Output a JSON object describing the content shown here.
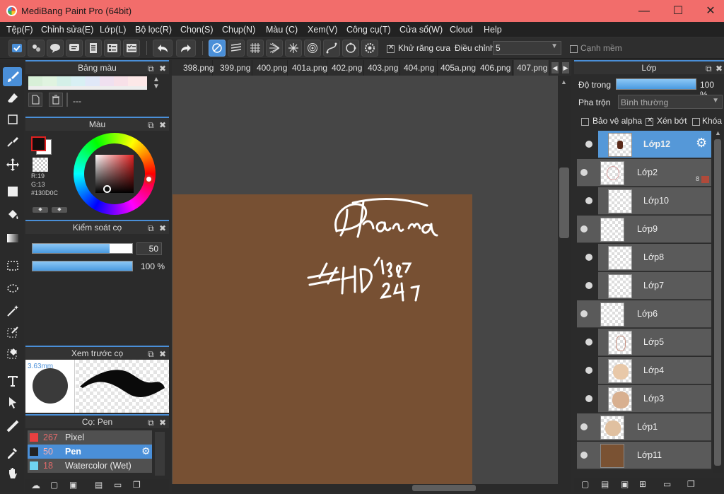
{
  "window": {
    "title": "MediBang Paint Pro (64bit)",
    "min": "—",
    "max": "☐",
    "close": "✕"
  },
  "menu": [
    "Tệp(F)",
    "Chỉnh sửa(E)",
    "Lớp(L)",
    "Bộ lọc(R)",
    "Chọn(S)",
    "Chụp(N)",
    "Màu (C)",
    "Xem(V)",
    "Công cụ(T)",
    "Cửa sổ(W)",
    "Cloud",
    "Help"
  ],
  "toolbar": {
    "antialias_label": "Khử răng cưa",
    "adjust_label": "Điều chỉnh",
    "adjust_value": "5",
    "soft_edge_label": "Cạnh mềm"
  },
  "tabs": [
    "398.png",
    "399.png",
    "400.png",
    "401a.png",
    "402.png",
    "403.png",
    "404.png",
    "405a.png",
    "406.png",
    "407.png"
  ],
  "palette_panel": {
    "title": "Bảng màu",
    "name_text": "---"
  },
  "color_panel": {
    "title": "Màu",
    "r": "R:19",
    "g": "G:13",
    "hex": "#130D0C",
    "fg_color": "#130D0C"
  },
  "brush_control": {
    "title": "Kiểm soát cọ",
    "size_value": "50",
    "opacity_value": "100 %",
    "size_fraction": 0.77,
    "opacity_fraction": 1.0
  },
  "brush_preview": {
    "title": "Xem trước cọ",
    "size_text": "3.63mm"
  },
  "brush_list": {
    "title": "Cọ: Pen",
    "items": [
      {
        "num": "267",
        "name": "Pixel",
        "color": "#e84040",
        "selected": false
      },
      {
        "num": "50",
        "name": "Pen",
        "color": "#222222",
        "selected": true
      },
      {
        "num": "18",
        "name": "Watercolor (Wet)",
        "color": "#6fd3f0",
        "selected": false
      }
    ]
  },
  "layer_panel": {
    "title": "Lớp",
    "opacity_label": "Độ trong",
    "opacity_value": "100 %",
    "blend_label": "Pha trộn",
    "blend_value": "Bình thường",
    "protect_alpha": "Bảo vệ alpha",
    "clipping": "Xén bớt",
    "lock": "Khóa",
    "layers": [
      {
        "name": "Lớp12",
        "selected": true,
        "clip": true,
        "badge": ""
      },
      {
        "name": "Lớp2",
        "selected": false,
        "clip": false,
        "badge": "8"
      },
      {
        "name": "Lớp10",
        "selected": false,
        "clip": true,
        "badge": ""
      },
      {
        "name": "Lớp9",
        "selected": false,
        "clip": false,
        "badge": ""
      },
      {
        "name": "Lớp8",
        "selected": false,
        "clip": true,
        "badge": ""
      },
      {
        "name": "Lớp7",
        "selected": false,
        "clip": true,
        "badge": ""
      },
      {
        "name": "Lớp6",
        "selected": false,
        "clip": false,
        "badge": ""
      },
      {
        "name": "Lớp5",
        "selected": false,
        "clip": true,
        "badge": ""
      },
      {
        "name": "Lớp4",
        "selected": false,
        "clip": true,
        "badge": ""
      },
      {
        "name": "Lớp3",
        "selected": false,
        "clip": true,
        "badge": ""
      },
      {
        "name": "Lớp1",
        "selected": false,
        "clip": false,
        "badge": ""
      },
      {
        "name": "Lớp11",
        "selected": false,
        "clip": false,
        "badge": ""
      }
    ]
  },
  "colors": {
    "accent": "#4a8fd8",
    "titlebar": "#f26d6b",
    "canvas_bg": "#775033",
    "layer11_fill": "#7a5233"
  }
}
